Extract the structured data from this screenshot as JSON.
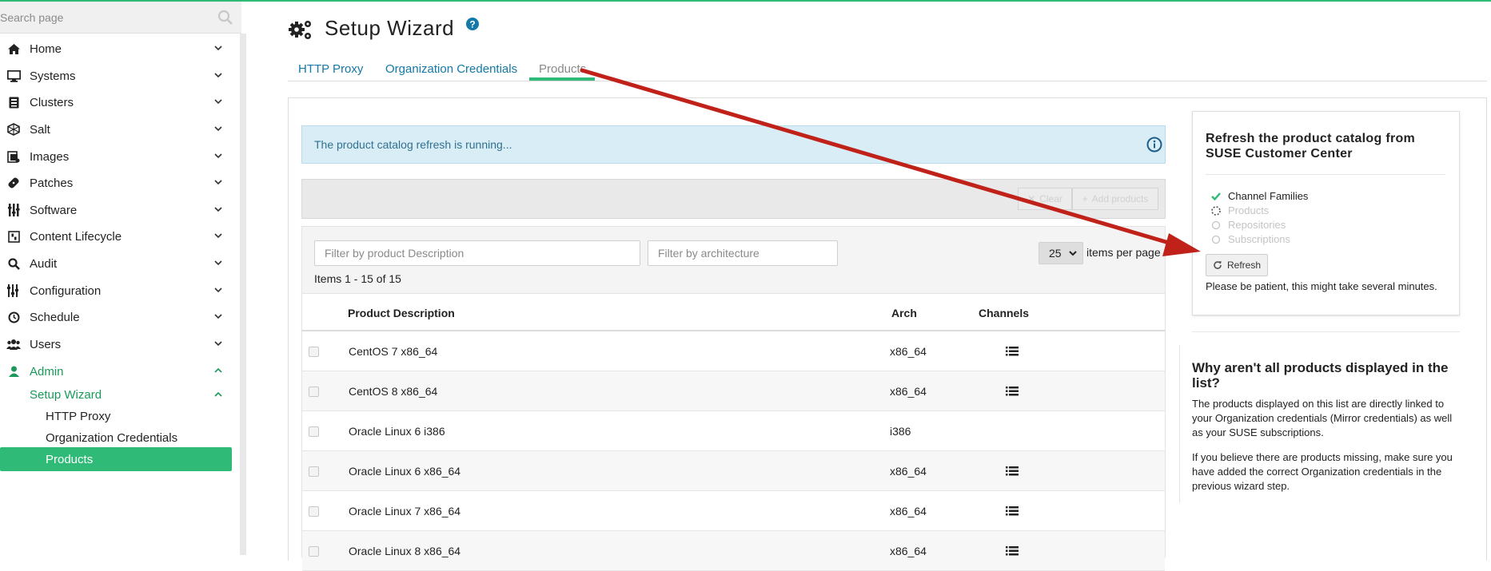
{
  "sidebar": {
    "search_placeholder": "Search page",
    "items": [
      {
        "label": "Home",
        "icon": "home-icon"
      },
      {
        "label": "Systems",
        "icon": "desktop-icon"
      },
      {
        "label": "Clusters",
        "icon": "clusters-icon"
      },
      {
        "label": "Salt",
        "icon": "salt-icon"
      },
      {
        "label": "Images",
        "icon": "images-icon"
      },
      {
        "label": "Patches",
        "icon": "patches-icon"
      },
      {
        "label": "Software",
        "icon": "software-icon"
      },
      {
        "label": "Content Lifecycle",
        "icon": "content-lifecycle-icon"
      },
      {
        "label": "Audit",
        "icon": "search-icon"
      },
      {
        "label": "Configuration",
        "icon": "sliders-icon"
      },
      {
        "label": "Schedule",
        "icon": "clock-icon"
      },
      {
        "label": "Users",
        "icon": "users-icon"
      },
      {
        "label": "Admin",
        "icon": "user-icon"
      }
    ],
    "admin_sub": {
      "setup_wizard": "Setup Wizard",
      "children": [
        "HTTP Proxy",
        "Organization Credentials",
        "Products"
      ]
    }
  },
  "header": {
    "title": "Setup Wizard",
    "tabs": [
      "HTTP Proxy",
      "Organization Credentials",
      "Products"
    ]
  },
  "main": {
    "alert": "The product catalog refresh is running...",
    "toolbar": {
      "clear_label": "Clear",
      "add_label": "Add products"
    },
    "filters": {
      "description_placeholder": "Filter by product Description",
      "arch_placeholder": "Filter by architecture",
      "per_page": "25",
      "per_page_label": "items per page",
      "items_count": "Items 1 - 15 of 15"
    },
    "columns": [
      "Product Description",
      "Arch",
      "Channels"
    ],
    "rows": [
      {
        "desc": "CentOS 7 x86_64",
        "arch": "x86_64"
      },
      {
        "desc": "CentOS 8 x86_64",
        "arch": "x86_64"
      },
      {
        "desc": "Oracle Linux 6 i386",
        "arch": "i386"
      },
      {
        "desc": "Oracle Linux 6 x86_64",
        "arch": "x86_64"
      },
      {
        "desc": "Oracle Linux 7 x86_64",
        "arch": "x86_64"
      },
      {
        "desc": "Oracle Linux 8 x86_64",
        "arch": "x86_64"
      }
    ]
  },
  "refresh_panel": {
    "title": "Refresh the product catalog from SUSE Customer Center",
    "steps": [
      "Channel Families",
      "Products",
      "Repositories",
      "Subscriptions"
    ],
    "button": "Refresh",
    "note": "Please be patient, this might take several minutes."
  },
  "why_panel": {
    "title": "Why aren't all products displayed in the list?",
    "p1": "The products displayed on this list are directly linked to your Organization credentials (Mirror credentials) as well as your SUSE subscriptions.",
    "p2": "If you believe there are products missing, make sure you have added the correct Organization credentials in the previous wizard step."
  },
  "colors": {
    "accent": "#30ba78",
    "link": "#1478a8",
    "arrow": "#c0221a",
    "alert_bg": "#d9edf6"
  }
}
